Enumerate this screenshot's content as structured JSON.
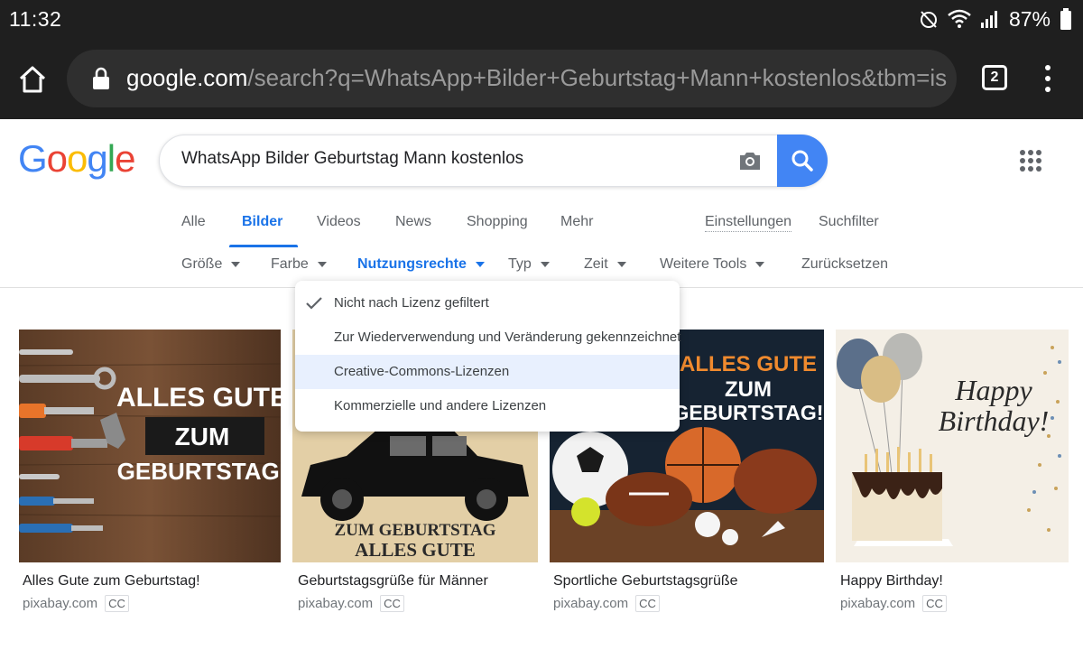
{
  "status_bar": {
    "time": "11:32",
    "battery": "87%"
  },
  "browser": {
    "url_host": "google.com",
    "url_path": "/search?q=WhatsApp+Bilder+Geburtstag+Mann+kostenlos&tbm=isch",
    "tab_count": "2"
  },
  "search": {
    "logo": "Google",
    "query": "WhatsApp Bilder Geburtstag Mann kostenlos"
  },
  "nav": {
    "tabs": [
      "Alle",
      "Bilder",
      "Videos",
      "News",
      "Shopping",
      "Mehr"
    ],
    "active_tab": "Bilder",
    "settings": "Einstellungen",
    "search_filter": "Suchfilter"
  },
  "tools": {
    "items": [
      "Größe",
      "Farbe",
      "Nutzungsrechte",
      "Typ",
      "Zeit",
      "Weitere Tools"
    ],
    "active": "Nutzungsrechte",
    "reset": "Zurücksetzen"
  },
  "dropdown": {
    "items": [
      "Nicht nach Lizenz gefiltert",
      "Zur Wiederverwendung und Veränderung gekennzeichnet",
      "Creative-Commons-Lizenzen",
      "Kommerzielle und andere Lizenzen"
    ],
    "checked_index": 0,
    "highlighted_index": 2
  },
  "results": [
    {
      "title": "Alles Gute zum Geburtstag!",
      "source": "pixabay.com",
      "badge": "CC",
      "image_text": [
        "ALLES GUTE",
        "ZUM",
        "GEBURTSTAG!"
      ]
    },
    {
      "title": "Geburtstagsgrüße für Männer",
      "source": "pixabay.com",
      "badge": "CC",
      "image_text": [
        "ZUM GEBURTSTAG",
        "ALLES GUTE"
      ]
    },
    {
      "title": "Sportliche Geburtstagsgrüße",
      "source": "pixabay.com",
      "badge": "CC",
      "image_text": [
        "ALLES GUTE",
        "ZUM",
        "GEBURTSTAG!"
      ]
    },
    {
      "title": "Happy Birthday!",
      "source": "pixabay.com",
      "badge": "CC",
      "image_text": [
        "Happy",
        "Birthday!"
      ]
    }
  ],
  "colors": {
    "google_blue": "#4285f4",
    "google_red": "#ea4335",
    "google_yellow": "#fbbc05",
    "google_green": "#34a853",
    "link_blue": "#1a73e8",
    "dark_bar": "#1f1f1f"
  }
}
